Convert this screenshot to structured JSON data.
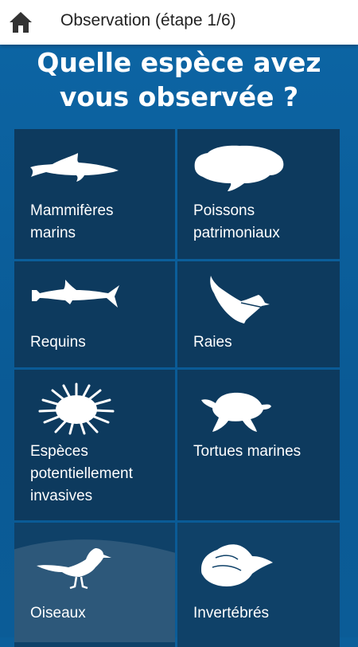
{
  "header": {
    "home_icon": "home-icon",
    "title": "Observation (étape 1/6)"
  },
  "question": {
    "line1": "Quelle espèce avez",
    "line2": "vous observée ?"
  },
  "categories": [
    {
      "label_line1": "Mammifères",
      "label_line2": "marins",
      "icon": "dolphin-icon"
    },
    {
      "label_line1": "Poissons",
      "label_line2": "patrimoniaux",
      "icon": "grouper-fish-icon"
    },
    {
      "label_line1": "Requins",
      "icon": "hammerhead-shark-icon"
    },
    {
      "label_line1": "Raies",
      "icon": "manta-ray-icon"
    },
    {
      "label_line1": "Espèces",
      "label_line2": "potentiellement",
      "label_line3": "invasives",
      "icon": "sea-urchin-icon"
    },
    {
      "label_line1": "Tortues marines",
      "icon": "sea-turtle-icon"
    },
    {
      "label_line1": "Oiseaux",
      "icon": "seabird-icon"
    },
    {
      "label_line1": "Invertébrés",
      "icon": "seashell-icon"
    }
  ],
  "colors": {
    "background": "#0b5f9b",
    "tile": "#0d3a5e",
    "header": "#ffffff"
  }
}
